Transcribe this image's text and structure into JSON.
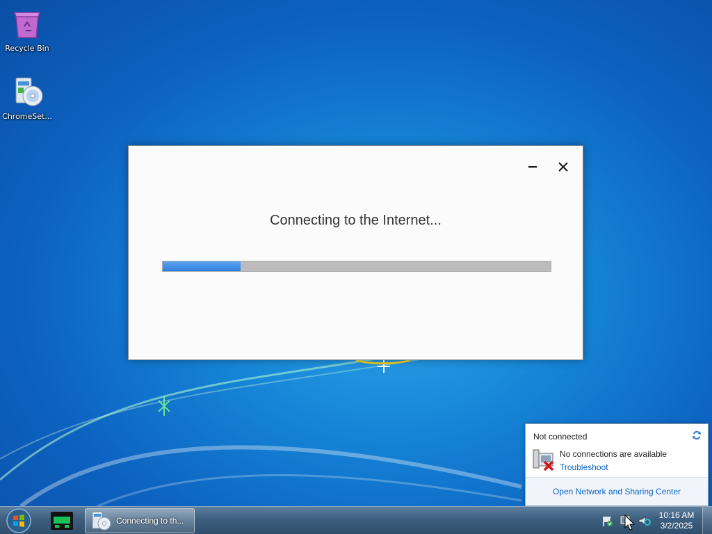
{
  "desktop": {
    "icons": [
      {
        "label": "Recycle Bin",
        "icon": "recycle-bin-icon"
      },
      {
        "label": "ChromeSet...",
        "icon": "installer-disc-icon"
      }
    ]
  },
  "dialog": {
    "message": "Connecting to the Internet...",
    "progress_fraction": 0.2,
    "minimize_icon": "minimize-icon",
    "close_icon": "close-icon"
  },
  "network_flyout": {
    "status_title": "Not connected",
    "message": "No connections are available",
    "troubleshoot_link": "Troubleshoot",
    "center_link": "Open Network and Sharing Center",
    "colors": {
      "link": "#0b64c0"
    }
  },
  "taskbar": {
    "task_label": "Connecting to th...",
    "clock": {
      "time": "10:16 AM",
      "date": "3/2/2025"
    }
  }
}
